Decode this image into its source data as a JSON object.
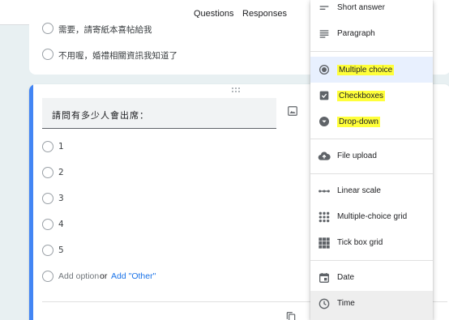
{
  "header": {
    "tabs": [
      {
        "label": "Questions",
        "active": true
      },
      {
        "label": "Responses",
        "active": false
      }
    ]
  },
  "previous_question": {
    "options": [
      "需要，請寄紙本喜帖給我",
      "不用喔，婚禮相關資訊我知道了"
    ]
  },
  "question": {
    "title": "請問有多少人會出席：",
    "options": [
      "1",
      "2",
      "3",
      "4",
      "5"
    ],
    "add_option": "Add option",
    "or_text": "or",
    "add_other": "Add \"Other\""
  },
  "type_menu": {
    "items": [
      {
        "label": "Short answer",
        "icon": "short-answer-icon"
      },
      {
        "label": "Paragraph",
        "icon": "paragraph-icon"
      },
      {
        "label": "Multiple choice",
        "icon": "radio-button-icon",
        "selected": true,
        "highlighted": true
      },
      {
        "label": "Checkboxes",
        "icon": "checkbox-icon",
        "highlighted": true
      },
      {
        "label": "Drop-down",
        "icon": "dropdown-circle-icon",
        "highlighted": true
      },
      {
        "label": "File upload",
        "icon": "cloud-upload-icon"
      },
      {
        "label": "Linear scale",
        "icon": "linear-scale-icon"
      },
      {
        "label": "Multiple-choice grid",
        "icon": "grid-dots-icon"
      },
      {
        "label": "Tick box grid",
        "icon": "tick-grid-icon"
      },
      {
        "label": "Date",
        "icon": "calendar-icon"
      },
      {
        "label": "Time",
        "icon": "clock-icon",
        "hovered": true
      }
    ]
  },
  "colors": {
    "accent_bar": "#4285f4",
    "tab_indicator": "#1b6a74",
    "highlighter": "#ffff3a",
    "selected_bg": "#e8f0fe",
    "link": "#1a73e8",
    "background": "#e8f0f2"
  }
}
